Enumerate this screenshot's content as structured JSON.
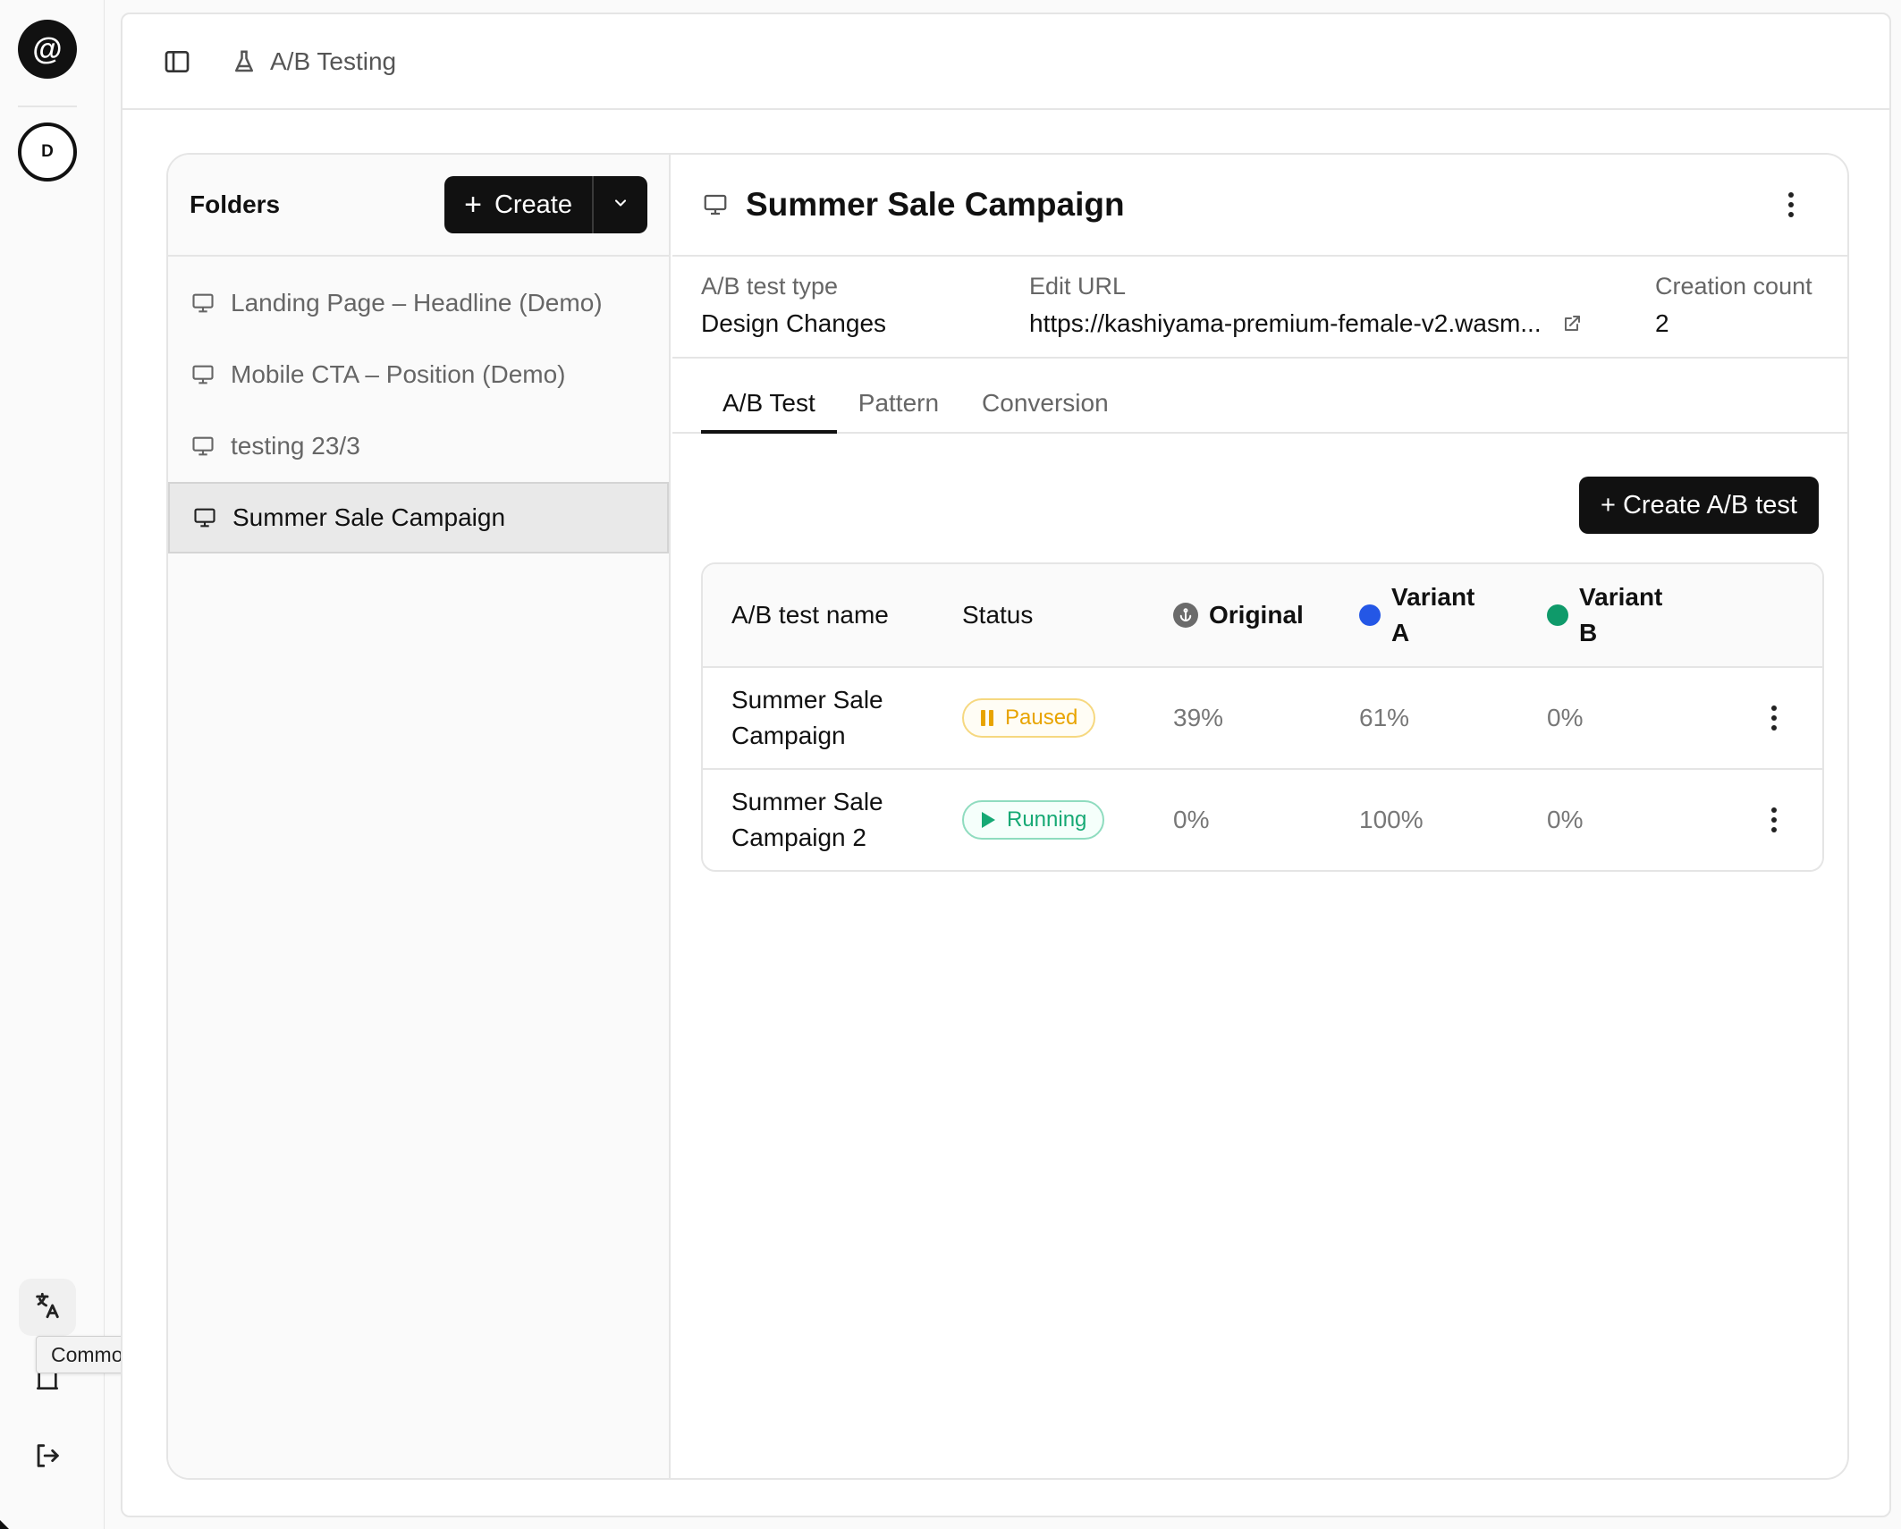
{
  "rail": {
    "logo_glyph": "@",
    "avatar_initial": "D",
    "tooltip": "Common Setting"
  },
  "topbar": {
    "breadcrumb": "A/B Testing"
  },
  "folders": {
    "title": "Folders",
    "create_label": "Create",
    "items": [
      {
        "label": "Landing Page – Headline (Demo)",
        "selected": false
      },
      {
        "label": "Mobile CTA – Position (Demo)",
        "selected": false
      },
      {
        "label": "testing 23/3",
        "selected": false
      },
      {
        "label": "Summer Sale Campaign",
        "selected": true
      }
    ]
  },
  "detail": {
    "title": "Summer Sale Campaign",
    "meta": {
      "type_label": "A/B test type",
      "type_value": "Design Changes",
      "url_label": "Edit URL",
      "url_value": "https://kashiyama-premium-female-v2.wasm...",
      "count_label": "Creation count",
      "count_value": "2"
    },
    "tabs": [
      "A/B Test",
      "Pattern",
      "Conversion"
    ],
    "active_tab": "A/B Test",
    "create_button": "+ Create A/B test",
    "table": {
      "headers": {
        "name": "A/B test name",
        "status": "Status",
        "original": "Original",
        "variant_a_line1": "Variant",
        "variant_a_line2": "A",
        "variant_b_line1": "Variant",
        "variant_b_line2": "B"
      },
      "rows": [
        {
          "name_line1": "Summer Sale",
          "name_line2": "Campaign",
          "status": "Paused",
          "original": "39%",
          "variant_a": "61%",
          "variant_b": "0%"
        },
        {
          "name_line1": "Summer Sale",
          "name_line2": "Campaign 2",
          "status": "Running",
          "original": "0%",
          "variant_a": "100%",
          "variant_b": "0%"
        }
      ]
    }
  },
  "colors": {
    "variant_a": "#2457e6",
    "variant_b": "#0f9a6a",
    "paused": "#e8a400",
    "running": "#16a974"
  }
}
